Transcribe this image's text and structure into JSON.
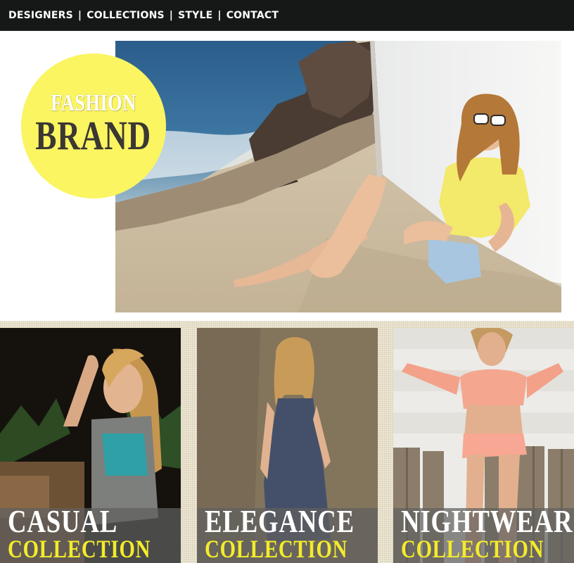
{
  "nav": {
    "items": [
      {
        "label": "DESIGNERS"
      },
      {
        "label": "COLLECTIONS"
      },
      {
        "label": "STYLE"
      },
      {
        "label": "CONTACT"
      }
    ],
    "separator": "|"
  },
  "hero": {
    "badge_line1": "FASHION",
    "badge_line2": "BRAND",
    "badge_color": "#faf561",
    "photo": "woman-sitting-on-beach-rocks"
  },
  "collections": [
    {
      "title": "CASUAL",
      "subtitle": "COLLECTION",
      "photo": "woman-casual-outdoor-night"
    },
    {
      "title": "ELEGANCE",
      "subtitle": "COLLECTION",
      "photo": "woman-navy-dress"
    },
    {
      "title": "NIGHTWEAR",
      "subtitle": "COLLECTION",
      "photo": "woman-pink-loungewear"
    }
  ],
  "colors": {
    "nav_bg": "#151817",
    "title_white": "#ffffff",
    "subtitle_yellow": "#f4ec2a",
    "background_linen": "#e7dfc9"
  }
}
